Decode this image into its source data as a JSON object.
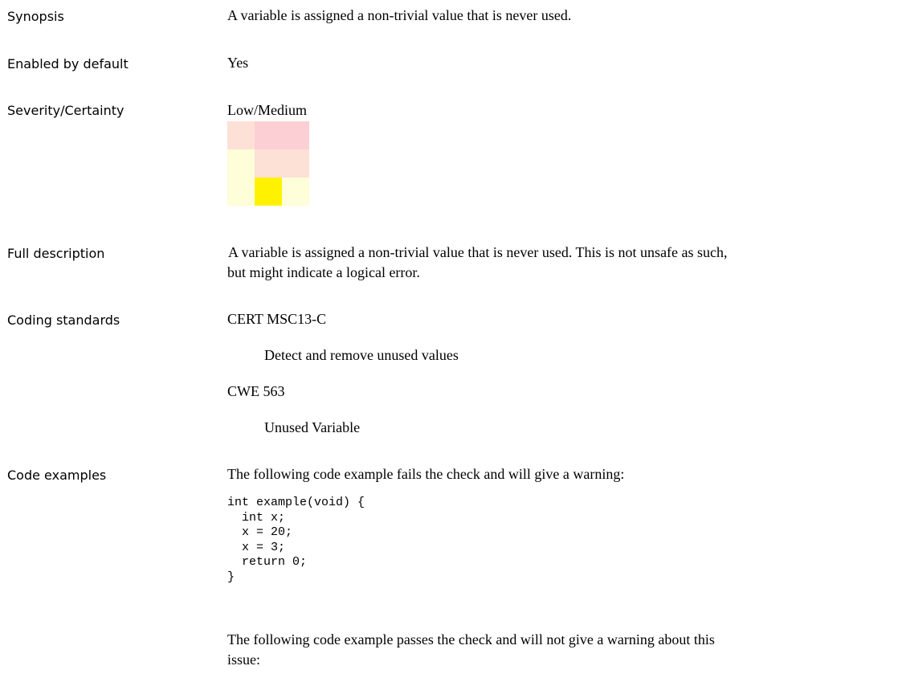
{
  "fields": {
    "synopsis": {
      "label": "Synopsis",
      "value": "A variable is assigned a non-trivial value that is never used."
    },
    "enabled": {
      "label": "Enabled by default",
      "value": "Yes"
    },
    "severity": {
      "label": "Severity/Certainty",
      "value": "Low/Medium",
      "matrix_colors": [
        [
          "#fde0d6",
          "#fccfd4",
          "#fccfd4"
        ],
        [
          "#fefed8",
          "#fde0d6",
          "#fde0d6"
        ],
        [
          "#fefed8",
          "#fff200",
          "#fefed8"
        ]
      ]
    },
    "full_description": {
      "label": "Full description",
      "line1": "A variable is assigned a non-trivial value that is never used.  This is not unsafe as such,",
      "line2": "but might indicate a logical error."
    },
    "coding_standards": {
      "label": "Coding standards",
      "items": [
        {
          "code": "CERT MSC13-C",
          "desc": "Detect and remove unused values"
        },
        {
          "code": "CWE 563",
          "desc": "Unused Variable"
        }
      ]
    },
    "code_examples": {
      "label": "Code examples",
      "fail_intro": "The following code example fails the check and will give a warning:",
      "code_lines": [
        "int example(void) {",
        "  int x;",
        "  x = 20;",
        "  x = 3;",
        "  return 0;",
        "}"
      ],
      "pass_intro_line1": "The following code example passes the check and will not give a warning about this",
      "pass_intro_line2": "issue:"
    }
  }
}
